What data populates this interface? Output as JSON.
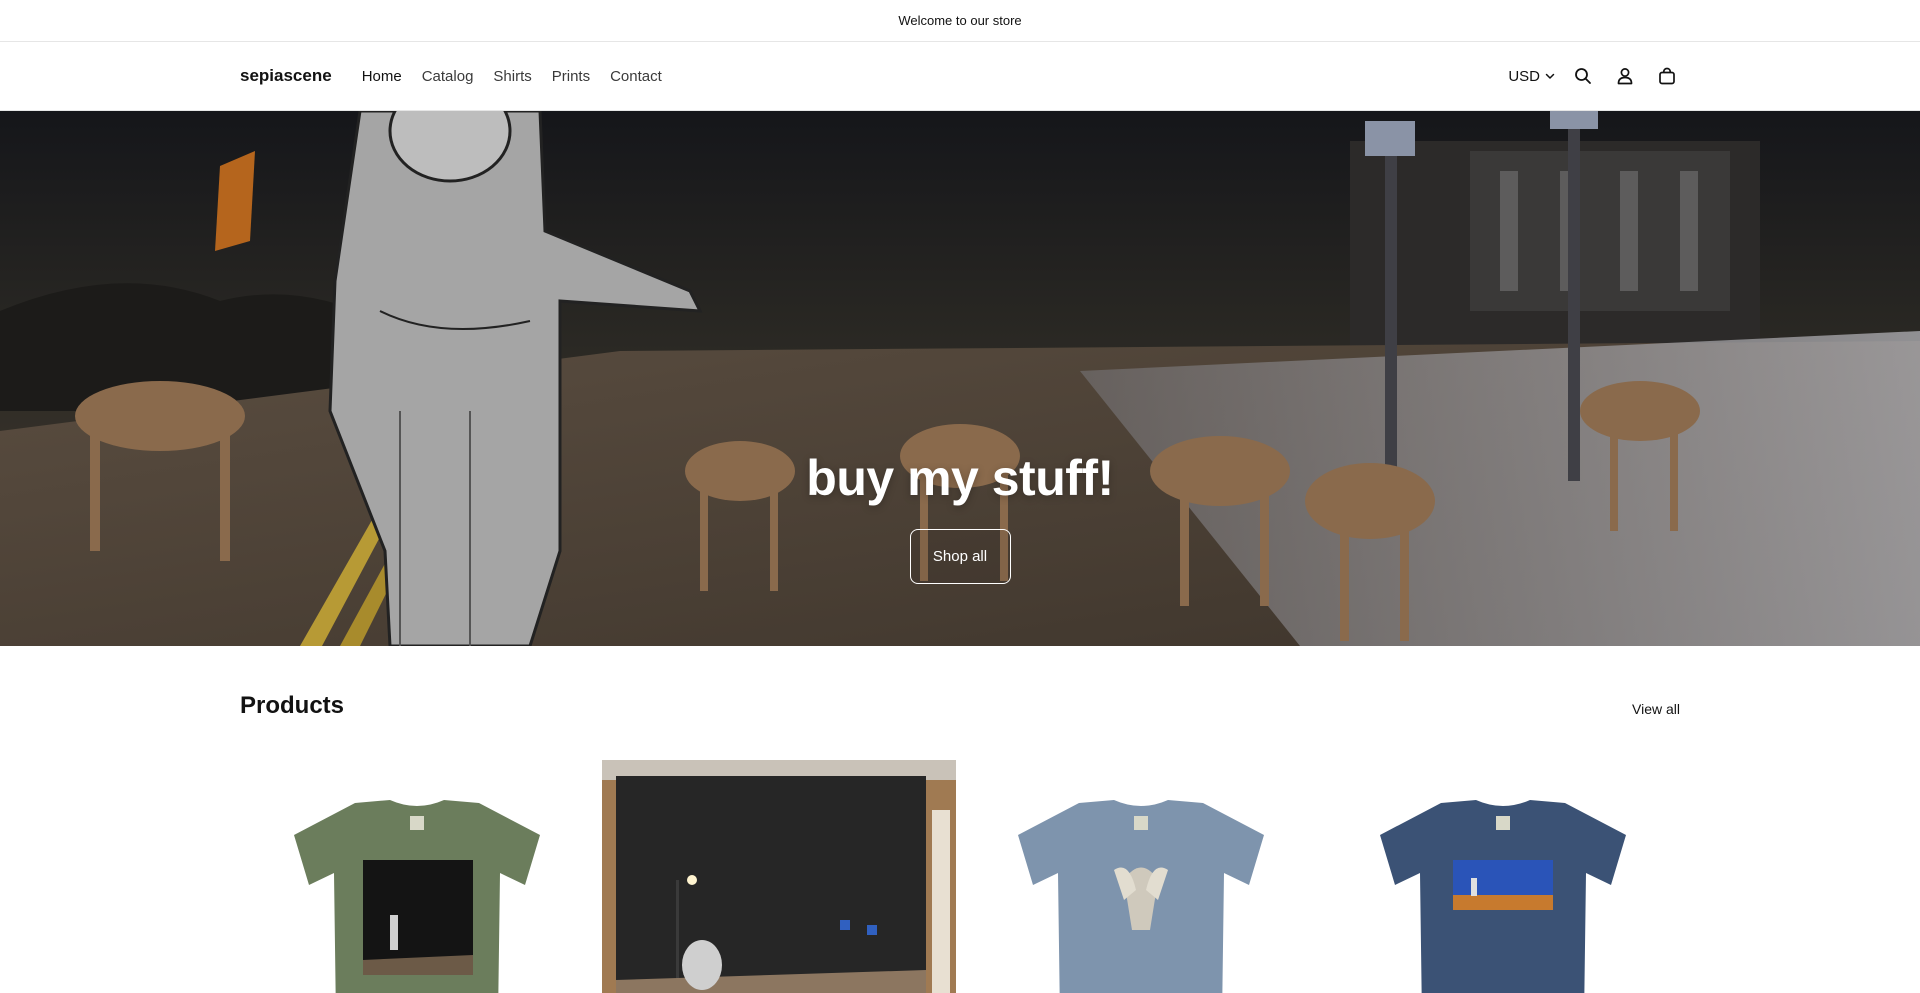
{
  "announcement": {
    "text": "Welcome to our store"
  },
  "header": {
    "logo": "sepiascene",
    "nav": [
      "Home",
      "Catalog",
      "Shirts",
      "Prints",
      "Contact"
    ],
    "currency": "USD",
    "icons": [
      "search-icon",
      "account-icon",
      "cart-icon"
    ]
  },
  "hero": {
    "title": "buy my stuff!",
    "button_label": "Shop all"
  },
  "products": {
    "title": "Products",
    "view_all": "View all",
    "items": [
      {
        "kind": "t-shirt",
        "shirt_color": "#6b7d5c",
        "print": "night road photo"
      },
      {
        "kind": "print",
        "shirt_color": "",
        "print": "framed night photo"
      },
      {
        "kind": "t-shirt",
        "shirt_color": "#7e94ad",
        "print": "angel statue"
      },
      {
        "kind": "t-shirt",
        "shirt_color": "#3b5275",
        "print": "blue evening street"
      }
    ]
  }
}
